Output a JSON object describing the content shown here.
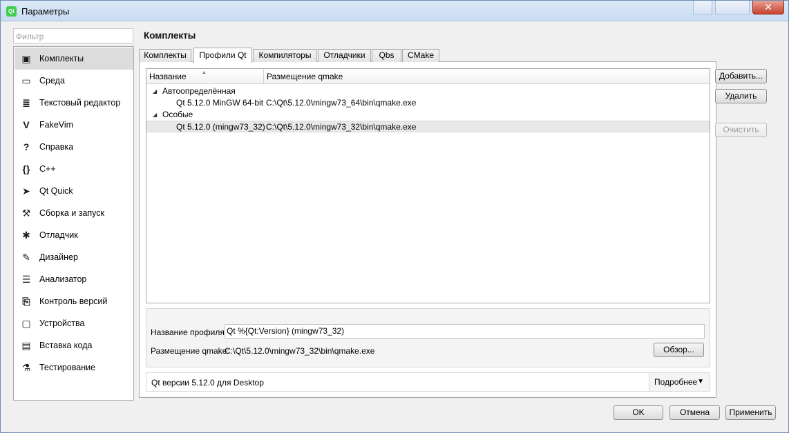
{
  "window": {
    "title": "Параметры",
    "app_icon_text": "Qt",
    "close_glyph": "✕"
  },
  "sidebar": {
    "filter_placeholder": "Фильтр",
    "items": [
      {
        "label": "Комплекты",
        "icon": "kits-icon",
        "glyph": "▣"
      },
      {
        "label": "Среда",
        "icon": "monitor-icon",
        "glyph": "▭"
      },
      {
        "label": "Текстовый редактор",
        "icon": "text-editor-icon",
        "glyph": "≣"
      },
      {
        "label": "FakeVim",
        "icon": "fakevim-icon",
        "glyph": "V"
      },
      {
        "label": "Справка",
        "icon": "help-icon",
        "glyph": "?"
      },
      {
        "label": "C++",
        "icon": "braces-icon",
        "glyph": "{}"
      },
      {
        "label": "Qt Quick",
        "icon": "paper-plane-icon",
        "glyph": "➤"
      },
      {
        "label": "Сборка и запуск",
        "icon": "hammer-icon",
        "glyph": "⚒"
      },
      {
        "label": "Отладчик",
        "icon": "bug-icon",
        "glyph": "✱"
      },
      {
        "label": "Дизайнер",
        "icon": "pencil-icon",
        "glyph": "✎"
      },
      {
        "label": "Анализатор",
        "icon": "analyzer-icon",
        "glyph": "☰"
      },
      {
        "label": "Контроль версий",
        "icon": "version-control-icon",
        "glyph": "⎘"
      },
      {
        "label": "Устройства",
        "icon": "devices-icon",
        "glyph": "▢"
      },
      {
        "label": "Вставка кода",
        "icon": "clipboard-icon",
        "glyph": "▤"
      },
      {
        "label": "Тестирование",
        "icon": "flask-icon",
        "glyph": "⚗"
      }
    ],
    "selected_index": 0
  },
  "section_title": "Комплекты",
  "tabs": [
    {
      "label": "Комплекты"
    },
    {
      "label": "Профили Qt"
    },
    {
      "label": "Компиляторы"
    },
    {
      "label": "Отладчики"
    },
    {
      "label": "Qbs"
    },
    {
      "label": "CMake"
    }
  ],
  "active_tab": 1,
  "tree": {
    "columns": [
      "Название",
      "Размещение qmake"
    ],
    "rows": [
      {
        "kind": "group",
        "name": "Автоопределённая",
        "path": ""
      },
      {
        "kind": "item",
        "name": "Qt 5.12.0 MinGW 64-bit",
        "path": "C:\\Qt\\5.12.0\\mingw73_64\\bin\\qmake.exe"
      },
      {
        "kind": "group",
        "name": "Особые",
        "path": ""
      },
      {
        "kind": "item",
        "name": "Qt 5.12.0 (mingw73_32)",
        "path": "C:\\Qt\\5.12.0\\mingw73_32\\bin\\qmake.exe",
        "selected": true
      }
    ],
    "expand_glyph": "◢"
  },
  "side_buttons": {
    "add": "Добавить...",
    "remove": "Удалить",
    "clean": "Очистить"
  },
  "details": {
    "profile_name_label": "Название профиля:",
    "profile_name_value": "Qt %{Qt:Version} (mingw73_32)",
    "qmake_label": "Размещение qmake:",
    "qmake_value": "C:\\Qt\\5.12.0\\mingw73_32\\bin\\qmake.exe",
    "browse": "Обзор..."
  },
  "version_bar": {
    "text": "Qt версии 5.12.0 для Desktop",
    "more": "Подробнее",
    "more_glyph": "▼"
  },
  "dialog_buttons": {
    "ok": "OK",
    "cancel": "Отмена",
    "apply": "Применить"
  }
}
